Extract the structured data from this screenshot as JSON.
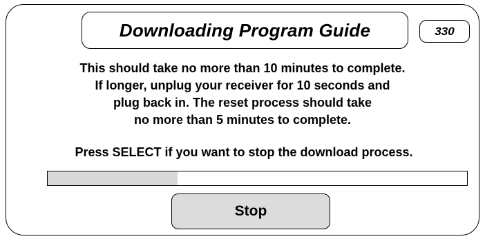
{
  "dialog": {
    "title": "Downloading Program Guide",
    "code": "330",
    "message_lines": [
      "This should take no more than 10 minutes to complete.",
      "If longer, unplug your receiver for 10 seconds and",
      "plug back in.  The reset process should take",
      "no more than 5 minutes to complete."
    ],
    "instruction": "Press SELECT if you want to stop the download process.",
    "progress_fraction": 0.31,
    "stop_button_label": "Stop"
  },
  "colors": {
    "border": "#000000",
    "background": "#ffffff",
    "progress_fill": "#d9d9d9",
    "button_fill": "#dcdcdc"
  }
}
